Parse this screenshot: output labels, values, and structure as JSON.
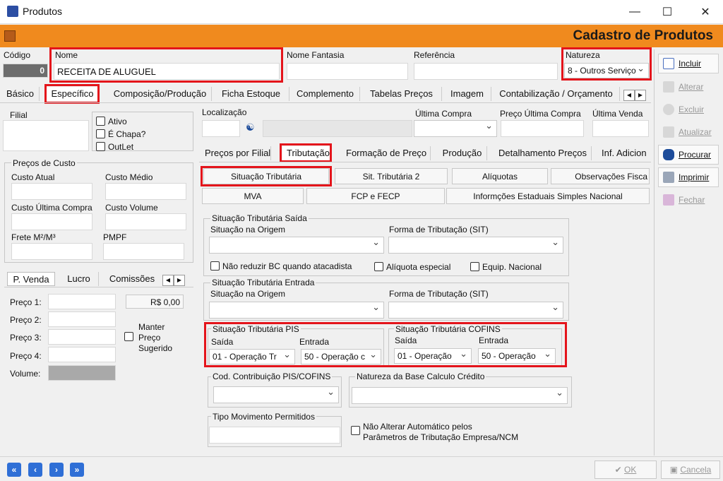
{
  "window": {
    "title": "Produtos",
    "minimize": "—",
    "maximize": "☐",
    "close": "✕"
  },
  "header": {
    "title": "Cadastro de Produtos"
  },
  "top": {
    "codigo_label": "Código",
    "codigo_value": "0",
    "nome_label": "Nome",
    "nome_value": "RECEITA DE ALUGUEL",
    "fantasia_label": "Nome Fantasia",
    "referencia_label": "Referência",
    "natureza_label": "Natureza",
    "natureza_value": "8 - Outros Serviço"
  },
  "main_tabs": [
    "Básico",
    "Específico",
    "Composição/Produção",
    "Ficha Estoque",
    "Complemento",
    "Tabelas Preços",
    "Imagem",
    "Contabilização / Orçamento"
  ],
  "filial": {
    "label": "Filial",
    "ativo": "Ativo",
    "chapa": "É Chapa?",
    "outlet": "OutLet"
  },
  "localizacao": {
    "label": "Localização",
    "ultima_compra": "Última Compra",
    "preco_ultima_compra": "Preço Última Compra",
    "ultima_venda": "Última Venda"
  },
  "custo": {
    "group": "Preços de Custo",
    "custo_atual": "Custo Atual",
    "custo_medio": "Custo Médio",
    "custo_ultima": "Custo Última Compra",
    "custo_volume": "Custo Volume",
    "frete": "Frete M²/M³",
    "pmpf": "PMPF"
  },
  "venda": {
    "tabs": [
      "P. Venda",
      "Lucro",
      "Comissões"
    ],
    "preco1": "Preço 1:",
    "preco2": "Preço 2:",
    "preco3": "Preço 3:",
    "preco4": "Preço 4:",
    "volume": "Volume:",
    "valor": "R$ 0,00",
    "manter": "Manter",
    "preco": "Preço",
    "sugerido": "Sugerido"
  },
  "sub_tabs": [
    "Preços por Filial",
    "Tributação",
    "Formação de Preço",
    "Produção",
    "Detalhamento Preços",
    "Inf. Adicion"
  ],
  "trib_buttons": {
    "row1": [
      "Situação Tributária",
      "Sit. Tributária 2",
      "Alíquotas",
      "Observações Fisca"
    ],
    "row2": [
      "MVA",
      "FCP e FECP",
      "Informções Estaduais Simples Nacional"
    ]
  },
  "saida": {
    "group": "Situação Tributária Saída",
    "origem": "Situação na Origem",
    "forma": "Forma de Tributação (SIT)",
    "nao_reduzir": "Não reduzir BC quando atacadista",
    "aliquota_especial": "Alíquota especial",
    "equip_nacional": "Equip. Nacional"
  },
  "entrada": {
    "group": "Situação Tributária Entrada",
    "origem": "Situação na Origem",
    "forma": "Forma de Tributação (SIT)"
  },
  "pis": {
    "group": "Situação Tributária PIS",
    "saida_label": "Saída",
    "entrada_label": "Entrada",
    "saida_value": "01 - Operação Tr",
    "entrada_value": "50 - Operação c"
  },
  "cofins": {
    "group": "Situação Tributária COFINS",
    "saida_label": "Saída",
    "entrada_label": "Entrada",
    "saida_value": "01 - Operação",
    "entrada_value": "50 - Operação"
  },
  "contribuicao": {
    "label": "Cod. Contribuição PIS/COFINS",
    "natureza_base": "Natureza da Base Calculo Crédito"
  },
  "movimento": {
    "label": "Tipo Movimento Permitidos",
    "nao_alterar_1": "Não Alterar Automático pelos",
    "nao_alterar_2": "Parâmetros de Tributação Empresa/NCM"
  },
  "side": {
    "incluir": "Incluir",
    "alterar": "Alterar",
    "excluir": "Excluir",
    "atualizar": "Atualizar",
    "procurar": "Procurar",
    "imprimir": "Imprimir",
    "fechar": "Fechar"
  },
  "footer": {
    "ok": "OK",
    "cancela": "Cancela",
    "first": "«",
    "prev": "‹",
    "next": "›",
    "last": "»"
  }
}
